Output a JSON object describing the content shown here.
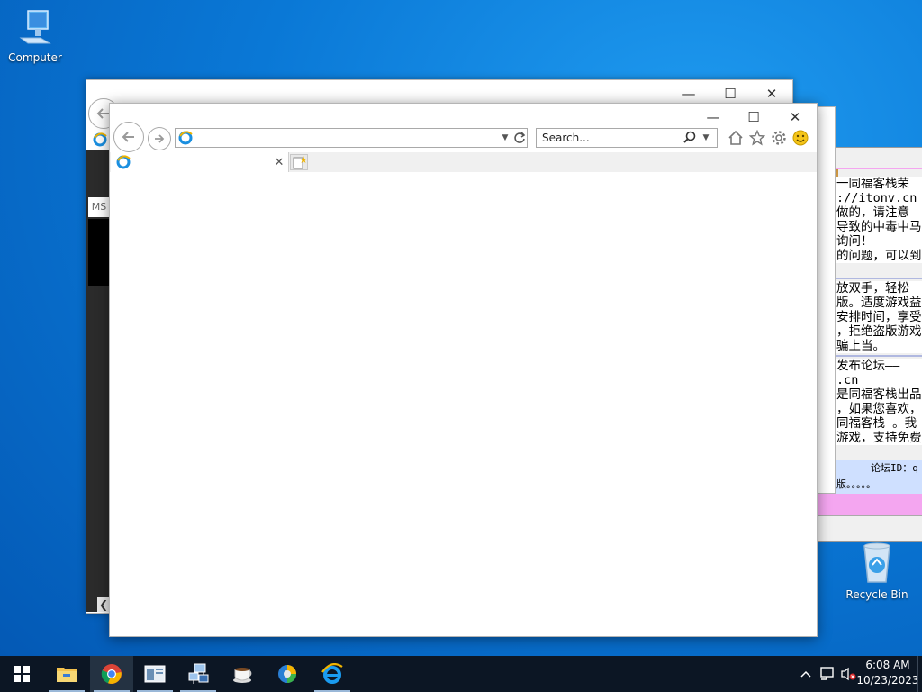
{
  "desktop": {
    "icons": [
      {
        "label": "Computer",
        "icon": "computer-icon"
      },
      {
        "label": "Recycle Bin",
        "icon": "recycle-bin-icon"
      }
    ]
  },
  "chinese_window": {
    "lines_top": [
      "一同福客栈荣",
      "://itonv.cn",
      "做的，请注意",
      "导致的中毒中马",
      "询问！",
      "的问题，可以到"
    ],
    "lines_mid": [
      "放双手，轻松",
      "版。适度游戏益",
      "安排时间，享受",
      "，拒绝盗版游戏",
      "骗上当。"
    ],
    "lines_low": [
      "发布论坛——",
      ".cn",
      "是同福客栈出品",
      "，如果您喜欢，",
      "同福客栈 。我",
      "游戏，支持免费"
    ],
    "forum_id": "论坛ID：q",
    "forum_tail": "版。。。。。"
  },
  "ie_middle": {
    "ms_label": "MS"
  },
  "ie_front": {
    "address_value": "",
    "search_placeholder": "Search...",
    "tab_title": ""
  },
  "taskbar": {
    "apps": [
      {
        "name": "start",
        "icon": "windows-start-icon"
      },
      {
        "name": "explorer",
        "icon": "file-explorer-icon"
      },
      {
        "name": "chrome",
        "icon": "chrome-icon",
        "active": true
      },
      {
        "name": "app-window",
        "icon": "app-window-icon"
      },
      {
        "name": "network-computer",
        "icon": "network-computer-icon"
      },
      {
        "name": "coffee",
        "icon": "coffee-cup-icon"
      },
      {
        "name": "orb",
        "icon": "colorful-orb-icon"
      },
      {
        "name": "internet-explorer",
        "icon": "internet-explorer-icon"
      }
    ],
    "time": "6:08 AM",
    "date": "10/23/2023"
  },
  "colors": {
    "desktop_accent": "#0a78d6",
    "taskbar": "#0c1624",
    "pink_band": "#f4a6f0"
  }
}
